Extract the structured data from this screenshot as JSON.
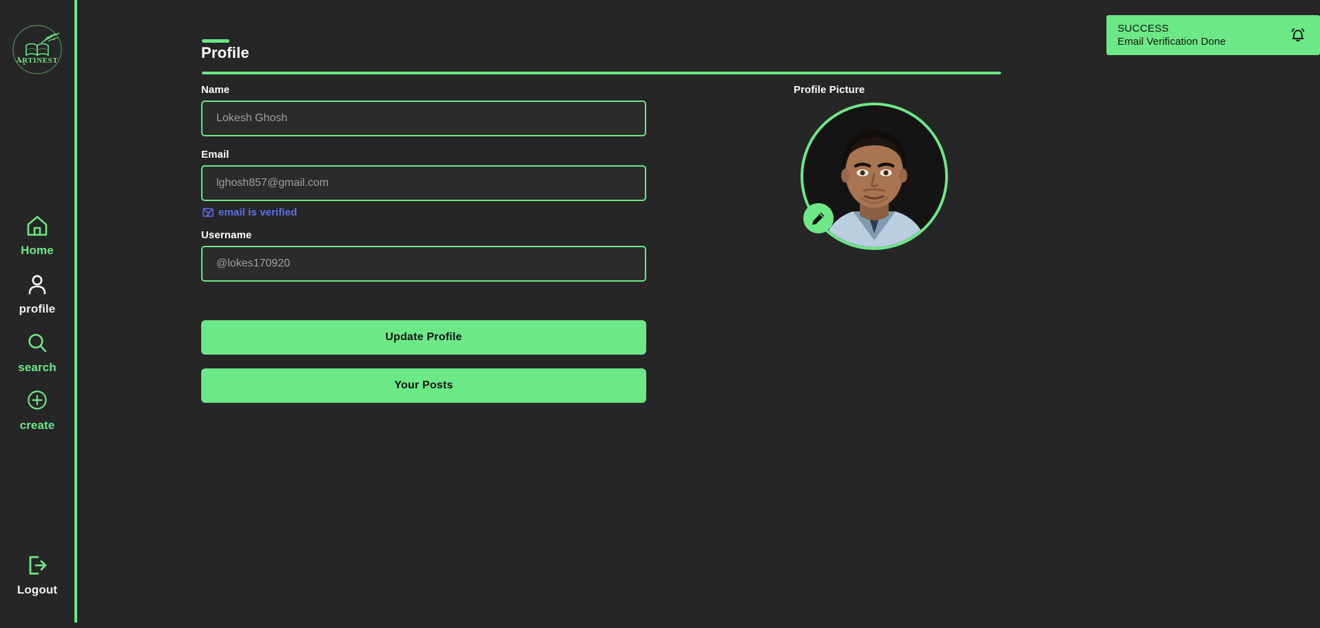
{
  "brand": {
    "name": "ARTINEST"
  },
  "sidebar": {
    "items": [
      {
        "id": "home",
        "label": "Home",
        "icon": "home-icon",
        "active": false
      },
      {
        "id": "profile",
        "label": "profile",
        "icon": "user-icon",
        "active": true
      },
      {
        "id": "search",
        "label": "search",
        "icon": "search-icon",
        "active": false
      },
      {
        "id": "create",
        "label": "create",
        "icon": "plus-circle-icon",
        "active": false
      },
      {
        "id": "logout",
        "label": "Logout",
        "icon": "logout-icon",
        "active": false
      }
    ]
  },
  "page": {
    "title": "Profile"
  },
  "form": {
    "name": {
      "label": "Name",
      "value": "Lokesh Ghosh",
      "placeholder": "Lokesh Ghosh"
    },
    "email": {
      "label": "Email",
      "value": "lghosh857@gmail.com",
      "placeholder": "lghosh857@gmail.com"
    },
    "email_verified": {
      "label": "email is verified",
      "icon": "envelope-check-icon",
      "color": "#5B6FE8"
    },
    "username": {
      "label": "Username",
      "value": "@lokes170920",
      "placeholder": "@lokes170920"
    },
    "update_button": "Update Profile",
    "posts_button": "Your Posts"
  },
  "avatar": {
    "section_label": "Profile Picture",
    "edit_icon": "pencil-icon"
  },
  "toast": {
    "title": "SUCCESS",
    "message": "Email Verification Done",
    "icon": "bell-ring-icon",
    "background": "#6DE887"
  },
  "colors": {
    "accent_green": "#6DE887",
    "background": "#262626",
    "text_primary": "#ffffff",
    "text_muted": "#a0a0a0",
    "link_blue": "#5B6FE8"
  }
}
